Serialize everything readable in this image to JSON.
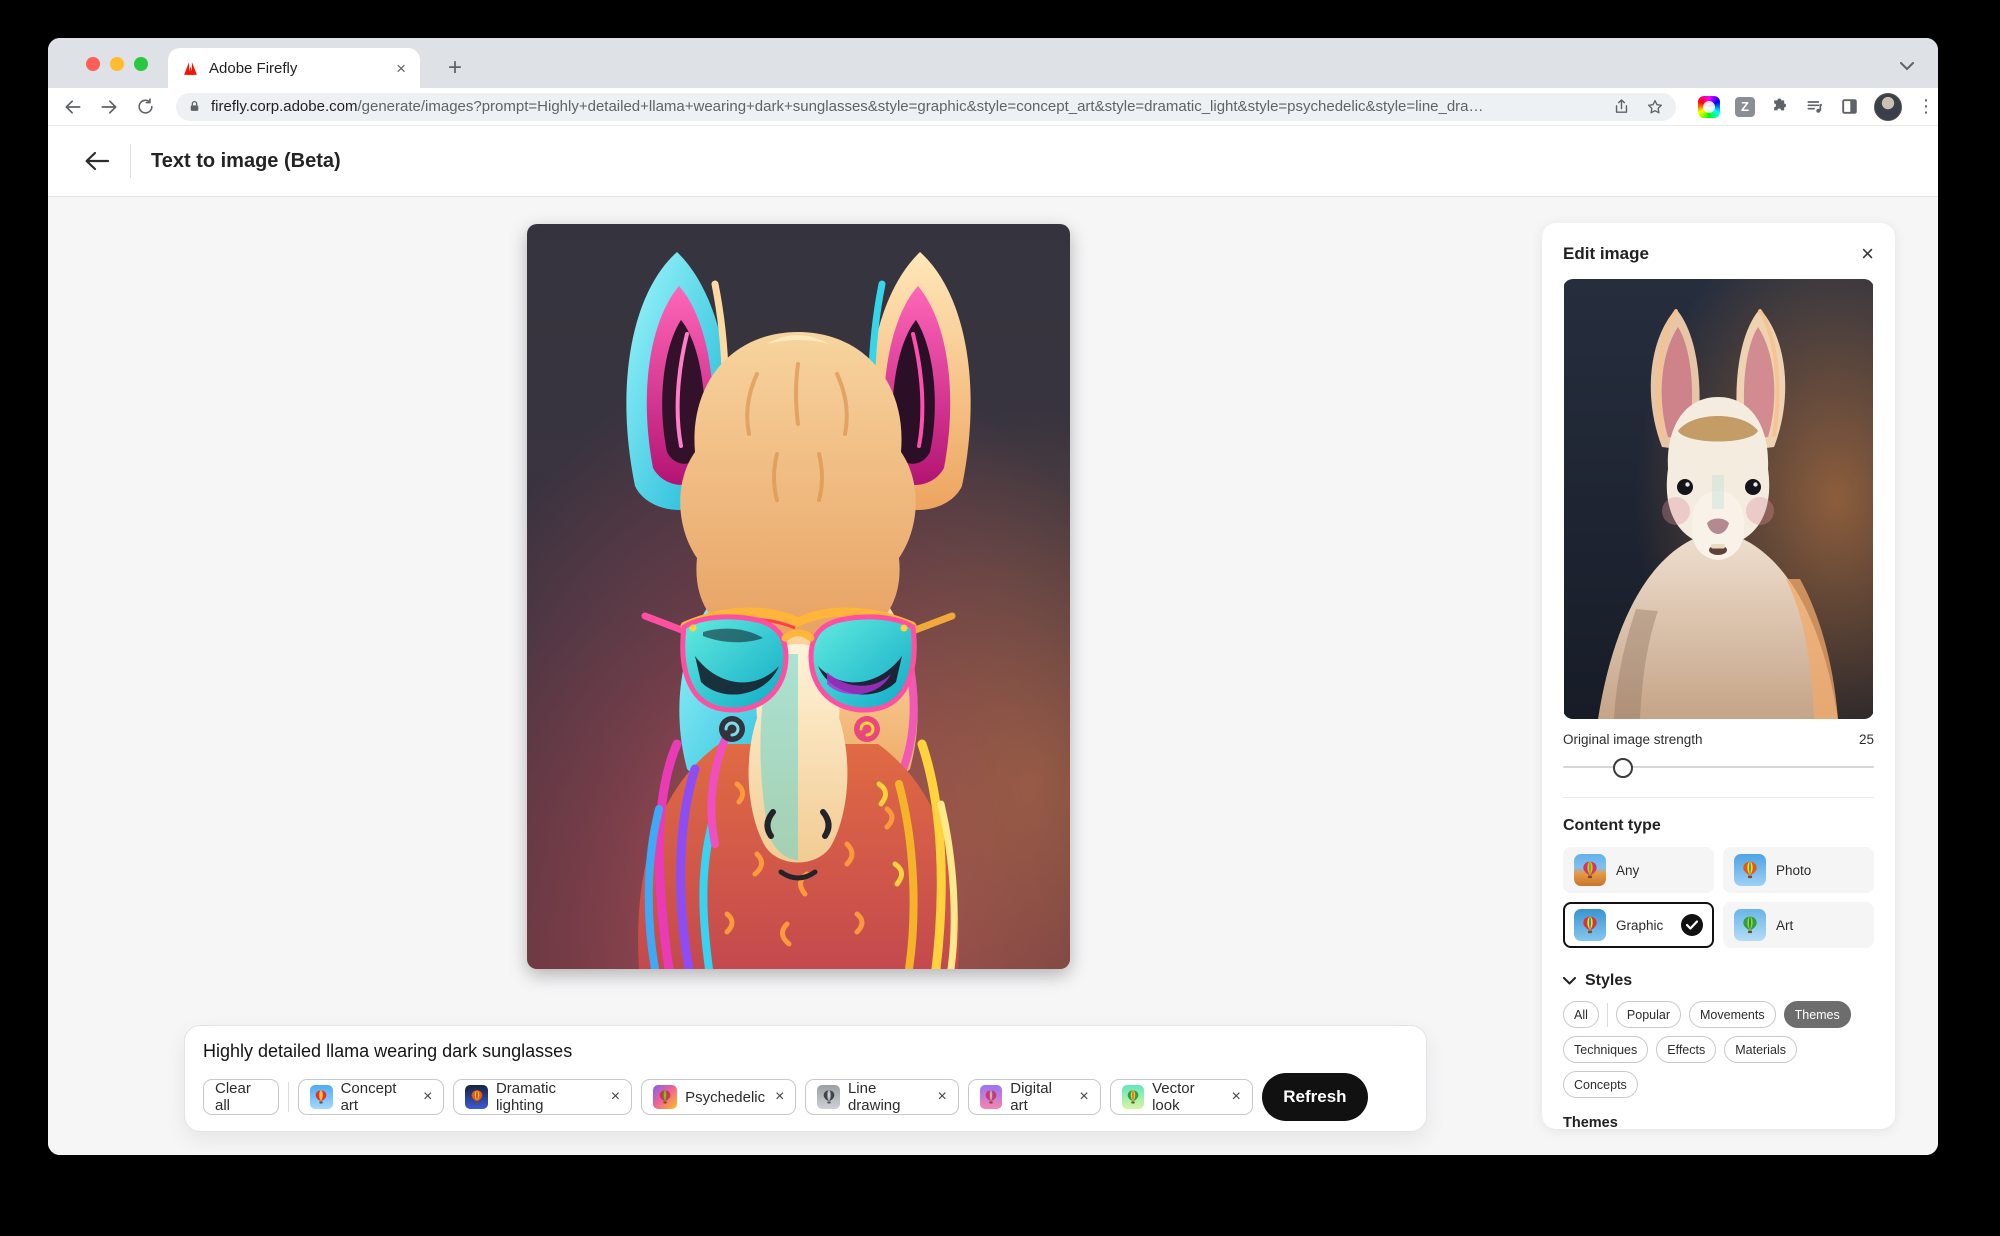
{
  "browser": {
    "tab_title": "Adobe Firefly",
    "url_domain": "firefly.corp.adobe.com",
    "url_path": "/generate/images?prompt=Highly+detailed+llama+wearing+dark+sunglasses&style=graphic&style=concept_art&style=dramatic_light&style=psychedelic&style=line_dra…"
  },
  "header": {
    "title": "Text to image (Beta)"
  },
  "edit_panel": {
    "title": "Edit image",
    "strength_label": "Original image strength",
    "strength_value": "25",
    "content_type": {
      "title": "Content type",
      "options": [
        {
          "label": "Any",
          "selected": false
        },
        {
          "label": "Photo",
          "selected": false
        },
        {
          "label": "Graphic",
          "selected": true
        },
        {
          "label": "Art",
          "selected": false
        }
      ]
    },
    "styles": {
      "title": "Styles",
      "filters": [
        "All",
        "Popular",
        "Movements",
        "Themes",
        "Techniques",
        "Effects",
        "Materials",
        "Concepts"
      ],
      "selected_filter": "Themes",
      "section_title": "Themes"
    }
  },
  "prompt_bar": {
    "prompt": "Highly detailed llama wearing dark sunglasses",
    "clear_all_label": "Clear all",
    "chips": [
      "Concept art",
      "Dramatic lighting",
      "Psychedelic",
      "Line drawing",
      "Digital art",
      "Vector look"
    ],
    "refresh_label": "Refresh"
  },
  "icons": {
    "tab_close": "×",
    "new_tab": "+",
    "panel_close": "×",
    "chip_remove": "×",
    "overflow_menu": "⋮",
    "z_extension": "Z"
  },
  "colors": {
    "refresh_button": "#111111",
    "selected_filter": "#6d6d6d",
    "selection_border": "#111111"
  }
}
